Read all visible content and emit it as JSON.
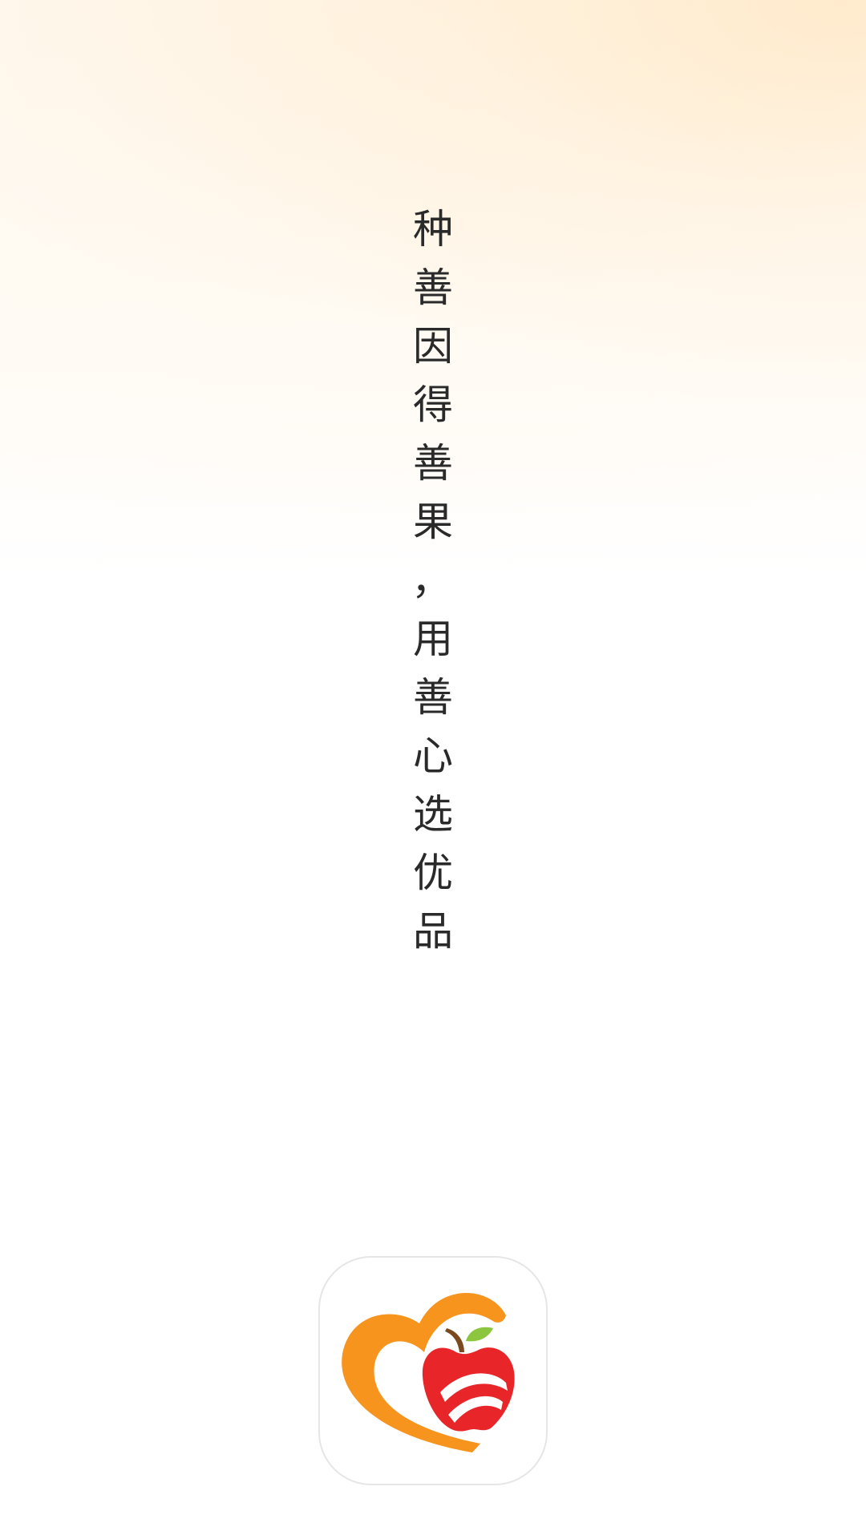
{
  "slogan": {
    "chars": [
      "种",
      "善",
      "因",
      "得",
      "善",
      "果",
      "，",
      "用",
      "善",
      "心",
      "选",
      "优",
      "品"
    ]
  },
  "logo": {
    "icon": "heart-apple-logo-icon",
    "heart_color": "#f7941d",
    "apple_color": "#e8262a",
    "leaf_color": "#8cc63f",
    "stem_color": "#7a4a1e"
  }
}
